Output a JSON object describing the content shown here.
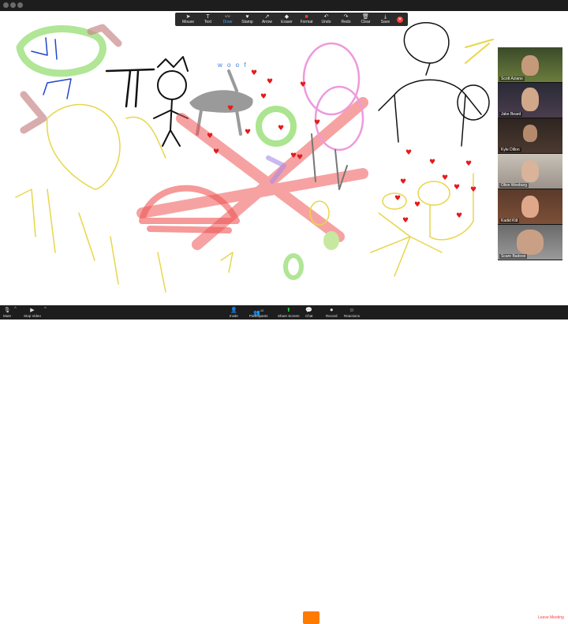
{
  "window": {
    "controls": [
      "close",
      "minimize",
      "maximize"
    ]
  },
  "annotation_toolbar": {
    "tools": [
      {
        "label": "Mouse",
        "icon": "mouse-pointer-icon"
      },
      {
        "label": "Text",
        "icon": "text-icon"
      },
      {
        "label": "Draw",
        "icon": "draw-icon"
      },
      {
        "label": "Stamp",
        "icon": "stamp-icon"
      },
      {
        "label": "Arrow",
        "icon": "arrow-icon"
      },
      {
        "label": "Eraser",
        "icon": "eraser-icon"
      },
      {
        "label": "Format",
        "icon": "format-icon"
      },
      {
        "label": "Undo",
        "icon": "undo-icon"
      },
      {
        "label": "Redo",
        "icon": "redo-icon"
      },
      {
        "label": "Clear",
        "icon": "trash-icon"
      },
      {
        "label": "Save",
        "icon": "save-icon"
      }
    ],
    "active": "Draw",
    "accent": "#4aa3ff"
  },
  "canvas": {
    "woof_text": "w o o f"
  },
  "gallery": {
    "participants": [
      {
        "name": "Scott Aziano"
      },
      {
        "name": "Jake Beard"
      },
      {
        "name": "Kyle Dillon"
      },
      {
        "name": "Olive Weeburg"
      },
      {
        "name": "Kadid Kitt"
      },
      {
        "name": "Scare Badose"
      }
    ]
  },
  "bottom_bar": {
    "mute_label": "Mute",
    "video_label": "Stop Video",
    "invite_label": "Invite",
    "participants_label": "Participants",
    "participants_count": "12",
    "share_label": "Share Screen",
    "chat_label": "Chat",
    "record_label": "Record",
    "reactions_label": "Reactions",
    "leave_label": "Leave Meeting",
    "leave_color": "#ff3b3b",
    "chat_color": "#ff7a00",
    "share_color": "#2ecc40"
  }
}
